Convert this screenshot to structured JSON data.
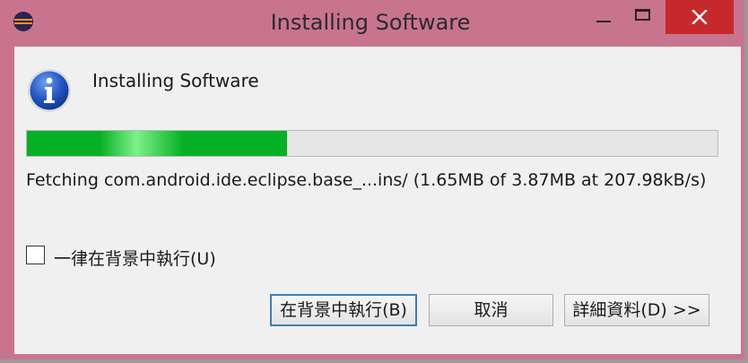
{
  "window": {
    "title": "Installing Software"
  },
  "dialog": {
    "header_title": "Installing Software",
    "progress_fraction": 0.376,
    "status_text": "Fetching com.android.ide.eclipse.base_...ins/ (1.65MB of 3.87MB at 207.98kB/s)",
    "checkbox_label": "一律在背景中執行(U)",
    "checkbox_checked": false
  },
  "buttons": {
    "run_in_background": "在背景中執行(B)",
    "cancel": "取消",
    "details": "詳細資料(D) >>"
  },
  "colors": {
    "frame": "#c9748f",
    "close_button": "#c7282c",
    "progress_green": "#06b025",
    "client_bg": "#f0f0f0"
  }
}
